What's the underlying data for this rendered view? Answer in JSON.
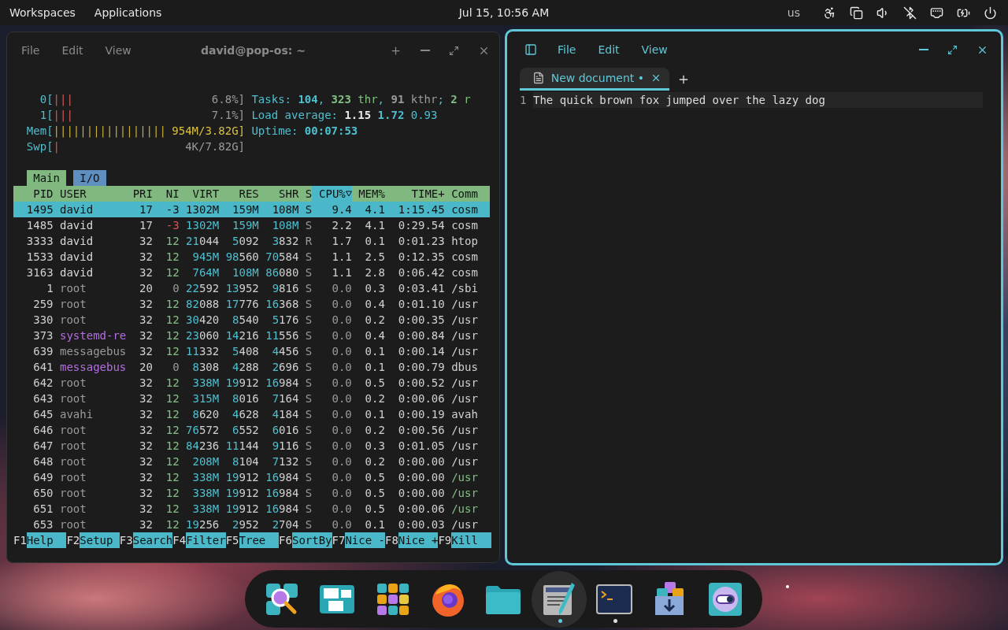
{
  "top_bar": {
    "menus": [
      "Workspaces",
      "Applications"
    ],
    "clock": "Jul 15, 10:56 AM",
    "keyboard_layout": "us",
    "indicators": [
      {
        "kind": "accessibility"
      },
      {
        "kind": "displays"
      },
      {
        "kind": "volume"
      },
      {
        "kind": "bluetooth_off"
      },
      {
        "kind": "network"
      },
      {
        "kind": "battery"
      },
      {
        "kind": "power"
      }
    ]
  },
  "terminal": {
    "title": "david@pop-os: ~",
    "menu": [
      "File",
      "Edit",
      "View"
    ],
    "meters": [
      {
        "kind": "cpu",
        "label": "0[",
        "bar": "|||",
        "reading": "6.8%]"
      },
      {
        "kind": "cpu",
        "label": "1[",
        "bar": "|||",
        "reading": "7.1%]"
      },
      {
        "kind": "mem",
        "label": "Mem[",
        "bar": "|||||||||||||||||",
        "reading": "954M/3.82G]"
      },
      {
        "kind": "swap",
        "label": "Swp[",
        "bar": "|",
        "reading": "4K/7.82G]"
      }
    ],
    "summary": [
      [
        {
          "t": "Tasks: ",
          "kind": "label"
        },
        {
          "t": "104",
          "kind": "cyan_b"
        },
        {
          "t": ", ",
          "kind": "label"
        },
        {
          "t": "323",
          "kind": "green_b"
        },
        {
          "t": " thr",
          "kind": "green"
        },
        {
          "t": ", ",
          "kind": "label"
        },
        {
          "t": "91",
          "kind": "grey_b"
        },
        {
          "t": " kthr",
          "kind": "grey"
        },
        {
          "t": "; ",
          "kind": "label"
        },
        {
          "t": "2",
          "kind": "green_b"
        },
        {
          "t": " r",
          "kind": "green"
        }
      ],
      [
        {
          "t": "Load average: ",
          "kind": "label"
        },
        {
          "t": "1.15 ",
          "kind": "white_b"
        },
        {
          "t": "1.72 ",
          "kind": "cyan_b"
        },
        {
          "t": "0.93",
          "kind": "label"
        }
      ],
      [
        {
          "t": "Uptime: ",
          "kind": "label"
        },
        {
          "t": "00:07:53",
          "kind": "cyan_b"
        }
      ]
    ],
    "tabs": [
      {
        "label": "Main",
        "selected": true
      },
      {
        "label": "I/O",
        "selected": false
      }
    ],
    "columns": [
      {
        "label": "PID",
        "sorted": false
      },
      {
        "label": "USER",
        "sorted": false
      },
      {
        "label": "PRI",
        "sorted": false
      },
      {
        "label": "NI",
        "sorted": false
      },
      {
        "label": "VIRT",
        "sorted": false
      },
      {
        "label": "RES",
        "sorted": false
      },
      {
        "label": "SHR",
        "sorted": false
      },
      {
        "label": "S",
        "sorted": false
      },
      {
        "label": "CPU%",
        "sorted": true
      },
      {
        "label": "MEM%",
        "sorted": false
      },
      {
        "label": "TIME+",
        "sorted": false
      },
      {
        "label": "Comm",
        "sorted": false
      }
    ],
    "rows": [
      {
        "pid": "1495",
        "user": "david",
        "pri": "17",
        "ni": "-3",
        "virt": "1302M",
        "res": "159M",
        "shr": "108M",
        "s": "S",
        "cpu": "9.4",
        "mem": "4.1",
        "time": "1:15.45",
        "command": "cosm",
        "selected": true
      },
      {
        "pid": "1485",
        "user": "david",
        "color": "#d8d8d8",
        "pri": "17",
        "ni": "-3",
        "virt": "1302M",
        "res": "159M",
        "shr": "108M",
        "s": "S",
        "cpu": "2.2",
        "mem": "4.1",
        "time": "0:29.54",
        "command": "cosm",
        "thread": false,
        "selected": false
      },
      {
        "pid": "3333",
        "user": "david",
        "color": "#d8d8d8",
        "pri": "32",
        "ni": "12",
        "virt": "21044",
        "res": "5092",
        "shr": "3832",
        "s": "R",
        "cpu": "1.7",
        "mem": "0.1",
        "time": "0:01.23",
        "command": "htop",
        "thread": false,
        "selected": false
      },
      {
        "pid": "1533",
        "user": "david",
        "color": "#d8d8d8",
        "pri": "32",
        "ni": "12",
        "virt": "945M",
        "res": "98560",
        "shr": "70584",
        "s": "S",
        "cpu": "1.1",
        "mem": "2.5",
        "time": "0:12.35",
        "command": "cosm",
        "thread": false,
        "selected": false
      },
      {
        "pid": "3163",
        "user": "david",
        "color": "#d8d8d8",
        "pri": "32",
        "ni": "12",
        "virt": "764M",
        "res": "108M",
        "shr": "86080",
        "s": "S",
        "cpu": "1.1",
        "mem": "2.8",
        "time": "0:06.42",
        "command": "cosm",
        "thread": false,
        "selected": false
      },
      {
        "pid": "1",
        "user": "root",
        "color": "#9a9a9a",
        "pri": "20",
        "ni": "0",
        "virt": "22592",
        "res": "13952",
        "shr": "9816",
        "s": "S",
        "cpu": "0.0",
        "mem": "0.3",
        "time": "0:03.41",
        "command": "/sbi",
        "thread": false,
        "selected": false
      },
      {
        "pid": "259",
        "user": "root",
        "color": "#9a9a9a",
        "pri": "32",
        "ni": "12",
        "virt": "82088",
        "res": "17776",
        "shr": "16368",
        "s": "S",
        "cpu": "0.0",
        "mem": "0.4",
        "time": "0:01.10",
        "command": "/usr",
        "thread": false,
        "selected": false
      },
      {
        "pid": "330",
        "user": "root",
        "color": "#9a9a9a",
        "pri": "32",
        "ni": "12",
        "virt": "30420",
        "res": "8540",
        "shr": "5176",
        "s": "S",
        "cpu": "0.0",
        "mem": "0.2",
        "time": "0:00.35",
        "command": "/usr",
        "thread": false,
        "selected": false
      },
      {
        "pid": "373",
        "user": "systemd-re",
        "color": "#b36ee0",
        "pri": "32",
        "ni": "12",
        "virt": "23060",
        "res": "14216",
        "shr": "11556",
        "s": "S",
        "cpu": "0.0",
        "mem": "0.4",
        "time": "0:00.84",
        "command": "/usr",
        "thread": false,
        "selected": false
      },
      {
        "pid": "639",
        "user": "messagebus",
        "color": "#9a9a9a",
        "pri": "32",
        "ni": "12",
        "virt": "11332",
        "res": "5408",
        "shr": "4456",
        "s": "S",
        "cpu": "0.0",
        "mem": "0.1",
        "time": "0:00.14",
        "command": "/usr",
        "thread": false,
        "selected": false
      },
      {
        "pid": "641",
        "user": "messagebus",
        "color": "#b36ee0",
        "pri": "20",
        "ni": "0",
        "virt": "8308",
        "res": "4288",
        "shr": "2696",
        "s": "S",
        "cpu": "0.0",
        "mem": "0.1",
        "time": "0:00.79",
        "command": "dbus",
        "thread": false,
        "selected": false
      },
      {
        "pid": "642",
        "user": "root",
        "color": "#9a9a9a",
        "pri": "32",
        "ni": "12",
        "virt": "338M",
        "res": "19912",
        "shr": "16984",
        "s": "S",
        "cpu": "0.0",
        "mem": "0.5",
        "time": "0:00.52",
        "command": "/usr",
        "thread": false,
        "selected": false
      },
      {
        "pid": "643",
        "user": "root",
        "color": "#9a9a9a",
        "pri": "32",
        "ni": "12",
        "virt": "315M",
        "res": "8016",
        "shr": "7164",
        "s": "S",
        "cpu": "0.0",
        "mem": "0.2",
        "time": "0:00.06",
        "command": "/usr",
        "thread": false,
        "selected": false
      },
      {
        "pid": "645",
        "user": "avahi",
        "color": "#9a9a9a",
        "pri": "32",
        "ni": "12",
        "virt": "8620",
        "res": "4628",
        "shr": "4184",
        "s": "S",
        "cpu": "0.0",
        "mem": "0.1",
        "time": "0:00.19",
        "command": "avah",
        "thread": false,
        "selected": false
      },
      {
        "pid": "646",
        "user": "root",
        "color": "#9a9a9a",
        "pri": "32",
        "ni": "12",
        "virt": "76572",
        "res": "6552",
        "shr": "6016",
        "s": "S",
        "cpu": "0.0",
        "mem": "0.2",
        "time": "0:00.56",
        "command": "/usr",
        "thread": false,
        "selected": false
      },
      {
        "pid": "647",
        "user": "root",
        "color": "#9a9a9a",
        "pri": "32",
        "ni": "12",
        "virt": "84236",
        "res": "11144",
        "shr": "9116",
        "s": "S",
        "cpu": "0.0",
        "mem": "0.3",
        "time": "0:01.05",
        "command": "/usr",
        "thread": false,
        "selected": false
      },
      {
        "pid": "648",
        "user": "root",
        "color": "#9a9a9a",
        "pri": "32",
        "ni": "12",
        "virt": "208M",
        "res": "8104",
        "shr": "7132",
        "s": "S",
        "cpu": "0.0",
        "mem": "0.2",
        "time": "0:00.00",
        "command": "/usr",
        "thread": false,
        "selected": false
      },
      {
        "pid": "649",
        "user": "root",
        "color": "#9a9a9a",
        "pri": "32",
        "ni": "12",
        "virt": "338M",
        "res": "19912",
        "shr": "16984",
        "s": "S",
        "cpu": "0.0",
        "mem": "0.5",
        "time": "0:00.00",
        "command": "/usr",
        "thread": true,
        "selected": false
      },
      {
        "pid": "650",
        "user": "root",
        "color": "#9a9a9a",
        "pri": "32",
        "ni": "12",
        "virt": "338M",
        "res": "19912",
        "shr": "16984",
        "s": "S",
        "cpu": "0.0",
        "mem": "0.5",
        "time": "0:00.00",
        "command": "/usr",
        "thread": true,
        "selected": false
      },
      {
        "pid": "651",
        "user": "root",
        "color": "#9a9a9a",
        "pri": "32",
        "ni": "12",
        "virt": "338M",
        "res": "19912",
        "shr": "16984",
        "s": "S",
        "cpu": "0.0",
        "mem": "0.5",
        "time": "0:00.06",
        "command": "/usr",
        "thread": true,
        "selected": false
      },
      {
        "pid": "653",
        "user": "root",
        "color": "#9a9a9a",
        "pri": "32",
        "ni": "12",
        "virt": "19256",
        "res": "2952",
        "shr": "2704",
        "s": "S",
        "cpu": "0.0",
        "mem": "0.1",
        "time": "0:00.03",
        "command": "/usr",
        "thread": false,
        "selected": false
      }
    ],
    "function_keys": [
      {
        "key": "F1",
        "label": "Help"
      },
      {
        "key": "F2",
        "label": "Setup"
      },
      {
        "key": "F3",
        "label": "Search"
      },
      {
        "key": "F4",
        "label": "Filter"
      },
      {
        "key": "F5",
        "label": "Tree"
      },
      {
        "key": "F6",
        "label": "SortBy"
      },
      {
        "key": "F7",
        "label": "Nice -"
      },
      {
        "key": "F8",
        "label": "Nice +"
      },
      {
        "key": "F9",
        "label": "Kill"
      }
    ]
  },
  "editor": {
    "menu": [
      "File",
      "Edit",
      "View"
    ],
    "tabs": [
      {
        "title": "New document •",
        "selected": true
      }
    ],
    "lines": [
      {
        "number": "1",
        "text": "The quick brown fox jumped over the lazy dog"
      }
    ]
  },
  "dock": {
    "items": [
      {
        "kind": "launcher",
        "active": false,
        "running": false
      },
      {
        "kind": "workspaces",
        "active": false,
        "running": false
      },
      {
        "kind": "applications",
        "active": false,
        "running": false
      },
      {
        "kind": "browser",
        "active": false,
        "running": false
      },
      {
        "kind": "files",
        "active": false,
        "running": false
      },
      {
        "kind": "editor",
        "active": true,
        "running": true
      },
      {
        "kind": "terminal",
        "active": false,
        "running": true
      },
      {
        "kind": "store",
        "active": false,
        "running": false
      },
      {
        "kind": "settings",
        "active": false,
        "running": false
      }
    ]
  }
}
